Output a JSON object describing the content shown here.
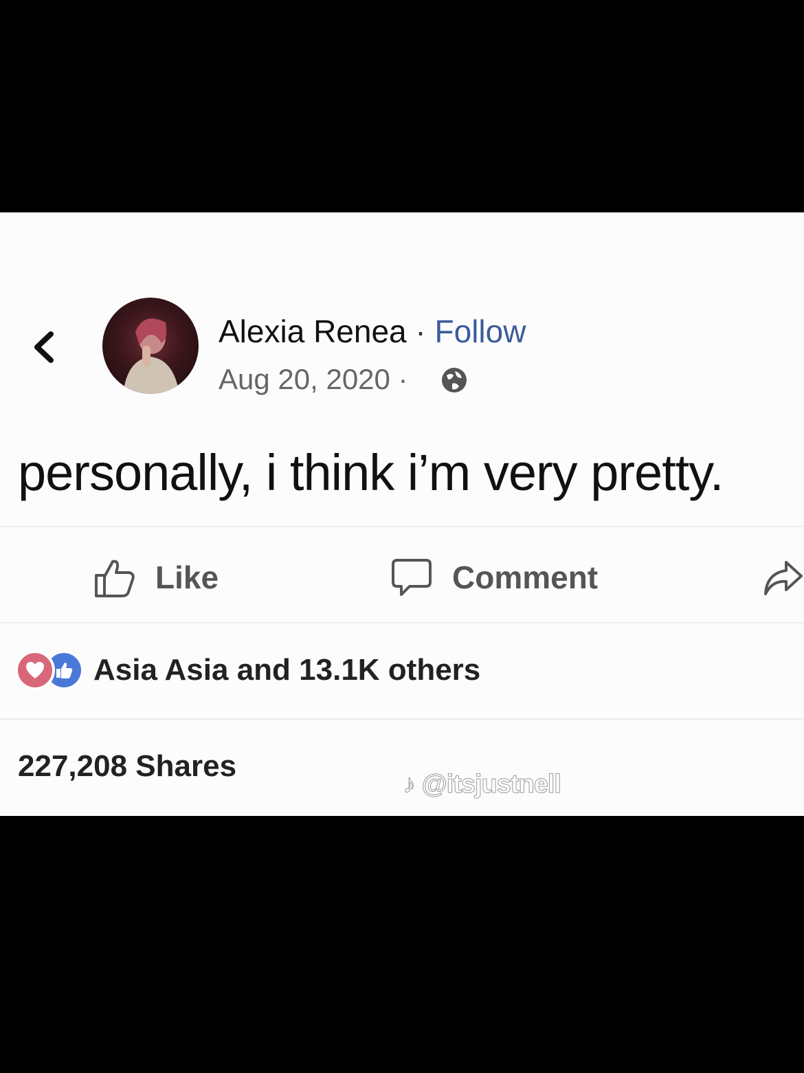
{
  "post": {
    "author": "Alexia Renea",
    "separator": " · ",
    "follow_label": "Follow",
    "date": "Aug 20, 2020 ·",
    "text": "personally, i think i’m very pretty."
  },
  "actions": {
    "like_label": "Like",
    "comment_label": "Comment"
  },
  "reactions": {
    "summary": "Asia Asia and 13.1K others"
  },
  "shares": {
    "label": "227,208 Shares"
  },
  "watermark": {
    "text": "@itsjustnell"
  },
  "colors": {
    "follow": "#3b5b9a",
    "heart": "#d9677a",
    "like": "#4a78d6"
  }
}
